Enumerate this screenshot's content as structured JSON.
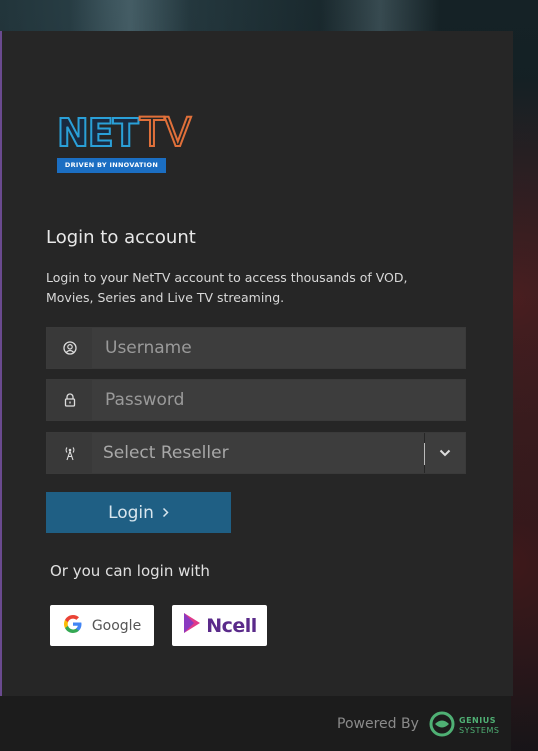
{
  "brand": {
    "logo_net": "NET",
    "logo_tv": "TV",
    "logo_tagline": "DRIVEN BY INNOVATION"
  },
  "login": {
    "title": "Login to account",
    "description": "Login to your NetTV account to access thousands of VOD, Movies, Series and Live TV streaming.",
    "username_placeholder": "Username",
    "password_placeholder": "Password",
    "reseller_selected": "Select Reseller",
    "login_label": "Login",
    "alt_text": "Or you can login with",
    "google_label": "Google",
    "ncell_label": "Ncell"
  },
  "footer": {
    "powered_by": "Powered By",
    "genius_line1": "GENIUS",
    "genius_line2": "SYSTEMS"
  },
  "colors": {
    "card_bg": "#262626",
    "login_button": "#1f5f84",
    "genius_green": "#4fb074"
  },
  "icons": {
    "username": "user-circle-icon",
    "password": "lock-icon",
    "reseller": "antenna-icon",
    "dropdown": "chevron-down-icon",
    "login": "chevron-right-icon"
  }
}
